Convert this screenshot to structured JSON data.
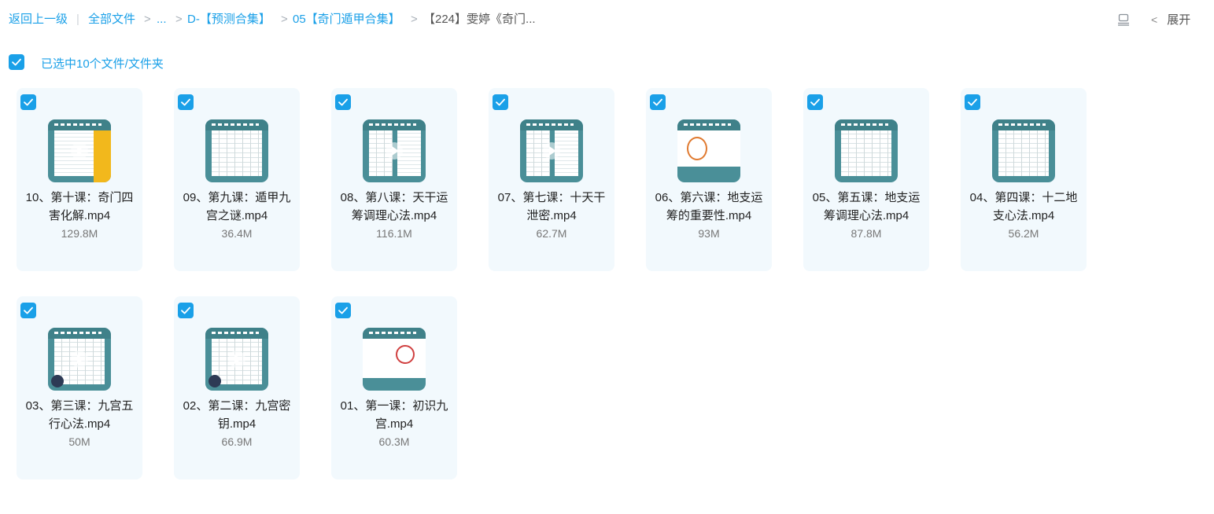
{
  "breadcrumb": {
    "back": "返回上一级",
    "divider": "|",
    "all_files": "全部文件",
    "ellipsis": "...",
    "folder1": "D-【预测合集】",
    "folder2": "05【奇门遁甲合集】",
    "current": "【224】雯婷《奇门...",
    "chevron": ">"
  },
  "toolbar": {
    "expand_label": "展开",
    "expand_arrow": "<",
    "list_view_icon": "list-view-icon"
  },
  "selection": {
    "text": "已选中10个文件/文件夹",
    "checked": true
  },
  "files": [
    {
      "name": "10、第十课：奇门四害化解.mp4",
      "size": "129.8M",
      "checked": true,
      "video": true
    },
    {
      "name": "09、第九课：遁甲九宫之谜.mp4",
      "size": "36.4M",
      "checked": true,
      "video": false
    },
    {
      "name": "08、第八课：天干运筹调理心法.mp4",
      "size": "116.1M",
      "checked": true,
      "video": true
    },
    {
      "name": "07、第七课：十天干泄密.mp4",
      "size": "62.7M",
      "checked": true,
      "video": true
    },
    {
      "name": "06、第六课：地支运筹的重要性.mp4",
      "size": "93M",
      "checked": true,
      "video": false
    },
    {
      "name": "05、第五课：地支运筹调理心法.mp4",
      "size": "87.8M",
      "checked": true,
      "video": false
    },
    {
      "name": "04、第四课：十二地支心法.mp4",
      "size": "56.2M",
      "checked": true,
      "video": false
    },
    {
      "name": "03、第三课：九宫五行心法.mp4",
      "size": "50M",
      "checked": true,
      "video": true
    },
    {
      "name": "02、第二课：九宫密钥.mp4",
      "size": "66.9M",
      "checked": true,
      "video": true
    },
    {
      "name": "01、第一课：初识九宫.mp4",
      "size": "60.3M",
      "checked": true,
      "video": false
    }
  ],
  "colors": {
    "accent": "#1aa0e8",
    "card_bg": "#f2f9fd",
    "thumb_teal": "#4a8f98"
  }
}
